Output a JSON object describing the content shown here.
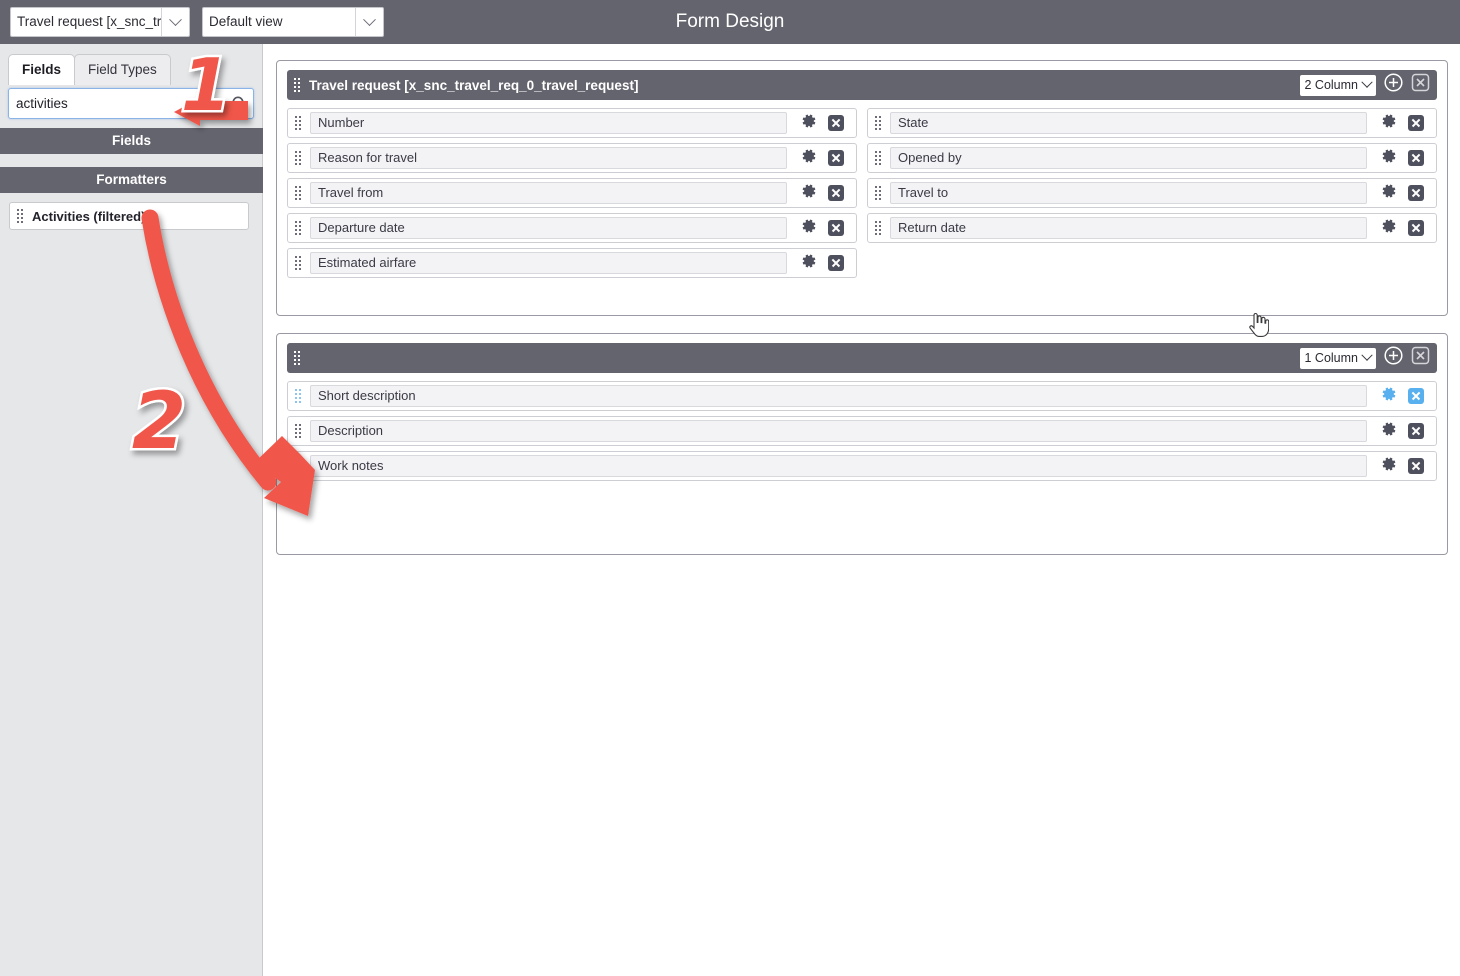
{
  "window": {
    "title": "Form Design"
  },
  "toolbar": {
    "table_select": {
      "value": "Travel request [x_snc_trav",
      "name": "table-select"
    },
    "view_select": {
      "value": "Default view",
      "name": "view-select"
    }
  },
  "sidebar": {
    "tabs": [
      {
        "label": "Fields",
        "active": true
      },
      {
        "label": "Field Types",
        "active": false
      }
    ],
    "search": {
      "value": "activities",
      "placeholder": "Search"
    },
    "groups": [
      {
        "label": "Fields",
        "items": []
      },
      {
        "label": "Formatters",
        "items": [
          {
            "label": "Activities (filtered)"
          }
        ]
      }
    ]
  },
  "form": {
    "sections": [
      {
        "title": "Travel request [x_snc_travel_req_0_travel_request]",
        "columns_label": "2 Column",
        "add_label": "+",
        "close_label": "×",
        "layout": "two",
        "rows": [
          {
            "left": "Number",
            "right": "State"
          },
          {
            "left": "Reason for travel",
            "right": "Opened by"
          },
          {
            "left": "Travel from",
            "right": "Travel to"
          },
          {
            "left": "Departure date",
            "right": "Return date"
          },
          {
            "left": "Estimated airfare",
            "right": null
          }
        ]
      },
      {
        "title": "",
        "columns_label": "1 Column",
        "add_label": "+",
        "close_label": "×",
        "layout": "one",
        "rows": [
          {
            "left": "Short description",
            "highlighted": true
          },
          {
            "left": "Description",
            "highlighted": false
          },
          {
            "left": "Work notes",
            "highlighted": false
          }
        ]
      }
    ]
  },
  "annotations": [
    {
      "number": "1",
      "target": "search-input"
    },
    {
      "number": "2",
      "target": "section-2-drop-zone"
    }
  ],
  "colors": {
    "chrome": "#64646e",
    "sidebar_bg": "#e6e7e9",
    "annotation": "#f0564a",
    "highlight": "#59b0ee",
    "field_bg": "#f3f3f5"
  }
}
